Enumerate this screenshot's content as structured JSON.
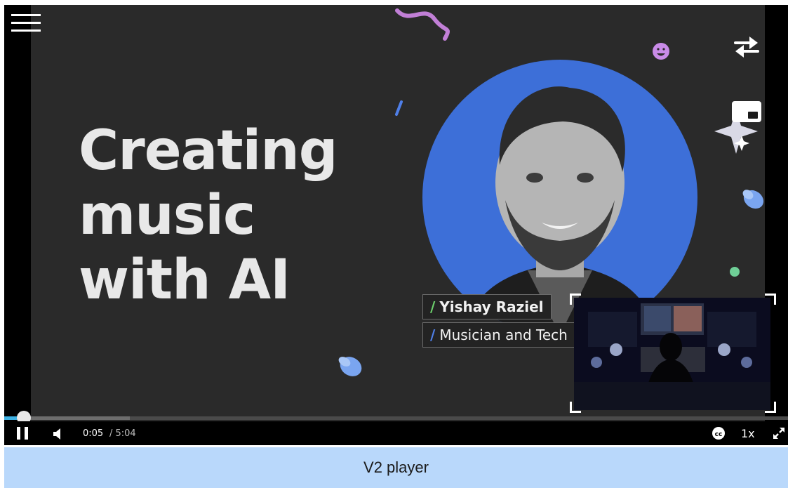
{
  "video": {
    "headline": [
      "Creating",
      "music",
      "with AI"
    ],
    "speaker_name": "Yishay Raziel",
    "speaker_role": "Musician and Tech",
    "tag_slash": "/",
    "accent_circle": "#3d6fd8"
  },
  "overlay": {
    "menu_icon": "hamburger-icon",
    "swap_icon": "swap-arrows-icon",
    "window_icon": "picture-in-picture-icon"
  },
  "controls": {
    "current_time": "0:05",
    "total_time": "/ 5:04",
    "speed": "1x",
    "progress_played": 0.016,
    "progress_buffered": 0.16,
    "play_state_icon": "pause-icon",
    "volume_icon": "speaker-icon",
    "cc_icon": "closed-captions-icon",
    "fullscreen_icon": "fullscreen-icon",
    "played_color": "#3fb2e4"
  },
  "caption": {
    "label": "V2 player"
  }
}
